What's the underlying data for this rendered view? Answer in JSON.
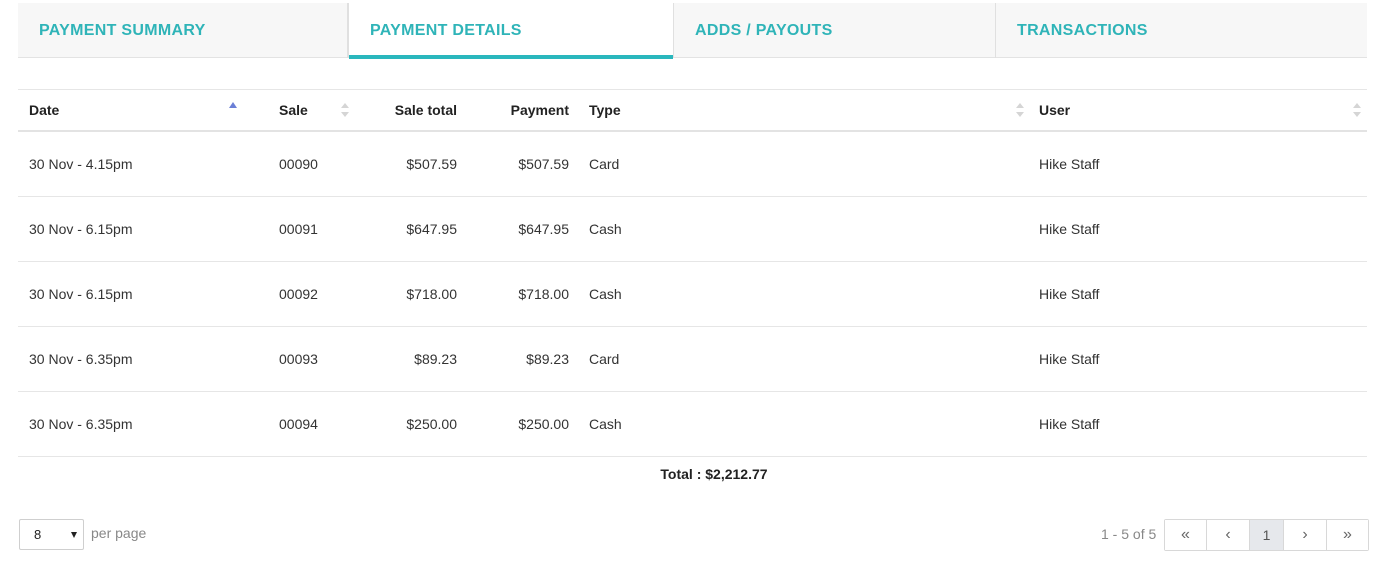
{
  "tabs": [
    {
      "label": "PAYMENT SUMMARY",
      "active": false
    },
    {
      "label": "PAYMENT DETAILS",
      "active": true
    },
    {
      "label": "ADDS / PAYOUTS",
      "active": false
    },
    {
      "label": "TRANSACTIONS",
      "active": false
    }
  ],
  "table": {
    "columns": {
      "date": "Date",
      "sale": "Sale",
      "sale_total": "Sale total",
      "payment": "Payment",
      "type": "Type",
      "user": "User"
    },
    "rows": [
      {
        "date": "30 Nov - 4.15pm",
        "sale": "00090",
        "sale_total": "$507.59",
        "payment": "$507.59",
        "type": "Card",
        "user": "Hike Staff"
      },
      {
        "date": "30 Nov - 6.15pm",
        "sale": "00091",
        "sale_total": "$647.95",
        "payment": "$647.95",
        "type": "Cash",
        "user": "Hike Staff"
      },
      {
        "date": "30 Nov - 6.15pm",
        "sale": "00092",
        "sale_total": "$718.00",
        "payment": "$718.00",
        "type": "Cash",
        "user": "Hike Staff"
      },
      {
        "date": "30 Nov - 6.35pm",
        "sale": "00093",
        "sale_total": "$89.23",
        "payment": "$89.23",
        "type": "Card",
        "user": "Hike Staff"
      },
      {
        "date": "30 Nov - 6.35pm",
        "sale": "00094",
        "sale_total": "$250.00",
        "payment": "$250.00",
        "type": "Cash",
        "user": "Hike Staff"
      }
    ],
    "total": "Total : $2,212.77"
  },
  "footer": {
    "per_page_value": "8",
    "per_page_label": "per page",
    "range": "1 - 5 of 5",
    "pager": {
      "first": "«",
      "prev": "‹",
      "current_page": "1",
      "next": "›",
      "last": "»"
    }
  },
  "colors": {
    "accent": "#2ab7bd",
    "tab_text": "#2fb4b8",
    "sort_active": "#6b7fd6"
  }
}
